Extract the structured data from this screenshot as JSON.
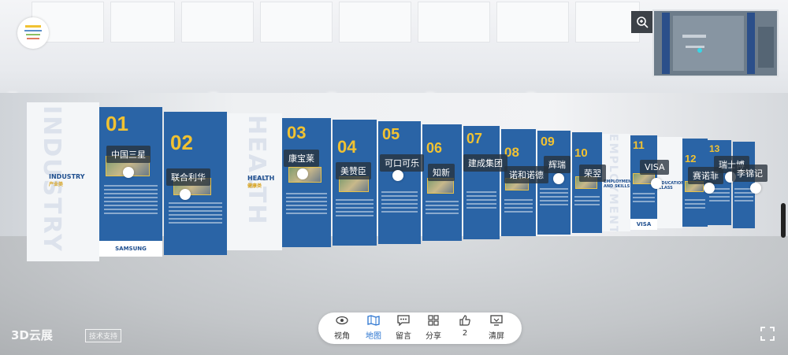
{
  "exhibits": [
    {
      "number": "01",
      "label": "中国三星",
      "footer": "SAMSUNG"
    },
    {
      "number": "02",
      "label": "联合利华",
      "footer": ""
    },
    {
      "number": "03",
      "label": "康宝莱",
      "footer": ""
    },
    {
      "number": "04",
      "label": "美赞臣",
      "footer": ""
    },
    {
      "number": "05",
      "label": "可口可乐",
      "footer": ""
    },
    {
      "number": "06",
      "label": "知新",
      "footer": ""
    },
    {
      "number": "07",
      "label": "建成集团",
      "footer": ""
    },
    {
      "number": "08",
      "label": "诺和诺德",
      "footer": ""
    },
    {
      "number": "09",
      "label": "辉瑞",
      "footer": ""
    },
    {
      "number": "10",
      "label": "荣翌",
      "footer": ""
    },
    {
      "number": "11",
      "label": "VISA",
      "footer": "VISA"
    },
    {
      "number": "12",
      "label": "赛诺菲",
      "footer": ""
    },
    {
      "number": "13",
      "label": "瑞士博",
      "footer": ""
    },
    {
      "number": "",
      "label": "李锦记",
      "footer": ""
    }
  ],
  "sectors": [
    {
      "en": "INDUSTRY",
      "cn": "产业类",
      "watermark": "INDUSTRY"
    },
    {
      "en": "HEALTH",
      "cn": "健康类",
      "watermark": "HEALTH"
    },
    {
      "en": "EMPLOYMENT AND SKILLS",
      "cn": "",
      "watermark": "EMPLOYMENT"
    },
    {
      "en": "EDUCATION CLASS",
      "cn": "",
      "watermark": ""
    }
  ],
  "toolbar": {
    "items": [
      {
        "label": "视角",
        "icon": "eye-icon"
      },
      {
        "label": "地图",
        "icon": "map-icon",
        "active": true
      },
      {
        "label": "留言",
        "icon": "message-icon"
      },
      {
        "label": "分享",
        "icon": "share-icon"
      },
      {
        "label": "2",
        "icon": "thumbs-up-icon"
      },
      {
        "label": "清屏",
        "icon": "clear-screen-icon"
      }
    ]
  },
  "brand": {
    "name": "3D云展",
    "support": "技术支持"
  },
  "colors": {
    "panel_blue": "#2a64a6",
    "number_gold": "#f1c232",
    "active_tab": "#2a74d0"
  }
}
